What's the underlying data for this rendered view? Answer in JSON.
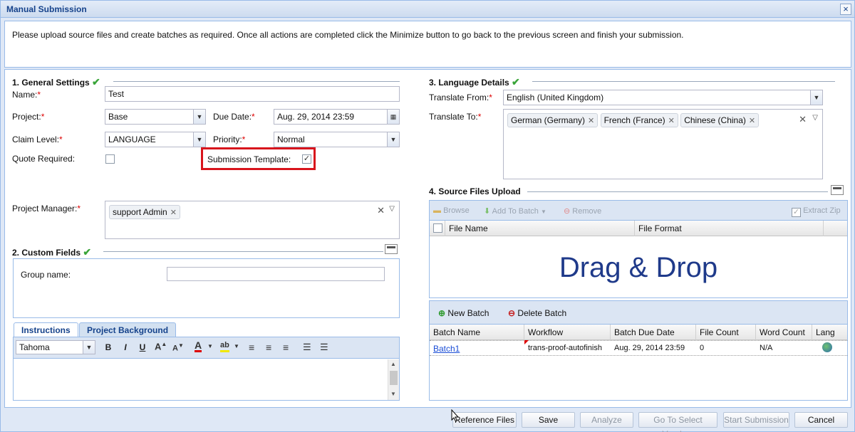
{
  "window": {
    "title": "Manual Submission",
    "close": "×"
  },
  "instructions": "Please upload source files and create batches as required. Once all actions are completed click the Minimize button to go back to the previous screen and finish your submission.",
  "general": {
    "title": "1. General Settings",
    "name_label": "Name:",
    "name_value": "Test",
    "project_label": "Project:",
    "project_value": "Base",
    "due_label": "Due Date:",
    "due_value": "Aug. 29, 2014 23:59",
    "claim_label": "Claim Level:",
    "claim_value": "LANGUAGE",
    "priority_label": "Priority:",
    "priority_value": "Normal",
    "quote_label": "Quote Required:",
    "template_label": "Submission Template:",
    "template_checked": "✓",
    "pm_label": "Project Manager:",
    "pm_tag": "support Admin"
  },
  "custom": {
    "title": "2. Custom Fields",
    "group_label": "Group name:"
  },
  "editor": {
    "tabs": [
      "Instructions",
      "Project Background"
    ],
    "font": "Tahoma",
    "buttons": [
      "B",
      "I",
      "U"
    ]
  },
  "language": {
    "title": "3. Language Details",
    "from_label": "Translate From:",
    "from_value": "English (United Kingdom)",
    "to_label": "Translate To:",
    "to_tags": [
      "German (Germany)",
      "French (France)",
      "Chinese (China)"
    ]
  },
  "upload": {
    "title": "4. Source Files Upload",
    "browse": "Browse",
    "add_to_batch": "Add To Batch",
    "remove": "Remove",
    "extract_zip": "Extract Zip",
    "col_file_name": "File Name",
    "col_file_format": "File Format",
    "drag_drop": "Drag & Drop"
  },
  "batch": {
    "new_batch": "New Batch",
    "delete_batch": "Delete Batch",
    "columns": [
      "Batch Name",
      "Workflow",
      "Batch Due Date",
      "File Count",
      "Word Count",
      "Lang"
    ],
    "row": {
      "name": "Batch1",
      "workflow": "trans-proof-autofinish",
      "due": "Aug. 29, 2014 23:59",
      "file_count": "0",
      "word_count": "N/A"
    }
  },
  "footer": {
    "reference_files": "Reference Files",
    "save": "Save",
    "analyze": "Analyze",
    "go_to_vendors": "Go To Select Vendors",
    "start_submission": "Start Submission",
    "cancel": "Cancel"
  },
  "colors": {
    "title": "#15428b",
    "required": "#dd0000",
    "highlight": "#d8141c",
    "drag_drop": "#1f3a8a"
  }
}
